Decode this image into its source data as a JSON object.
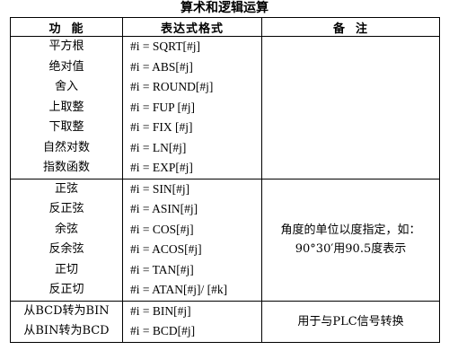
{
  "title": "算术和逻辑运算",
  "headers": {
    "function": "功  能",
    "expression": "表达式格式",
    "remarks": "备  注"
  },
  "groups": [
    {
      "functions": [
        "平方根",
        "绝对值",
        "舍入",
        "上取整",
        "下取整",
        "自然对数",
        "指数函数"
      ],
      "expressions": [
        "#i = SQRT[#j]",
        "#i = ABS[#j]",
        "#i = ROUND[#j]",
        "#i = FUP [#j]",
        "#i = FIX [#j]",
        "#i = LN[#j]",
        "#i = EXP[#j]"
      ],
      "remark_lines": []
    },
    {
      "functions": [
        "正弦",
        "反正弦",
        "余弦",
        "反余弦",
        "正切",
        "反正切"
      ],
      "expressions": [
        "#i = SIN[#j]",
        "#i = ASIN[#j]",
        "#i = COS[#j]",
        "#i = ACOS[#j]",
        "#i = TAN[#j]",
        "#i = ATAN[#j]/ [#k]"
      ],
      "remark_lines": [
        "角度的单位以度指定，如：",
        "90°30′用90.5度表示"
      ]
    },
    {
      "functions": [
        "从BCD转为BIN",
        "从BIN转为BCD"
      ],
      "expressions": [
        "#i = BIN[#j]",
        "#i = BCD[#j]"
      ],
      "remark_lines": [
        "用于与PLC信号转换"
      ]
    }
  ]
}
